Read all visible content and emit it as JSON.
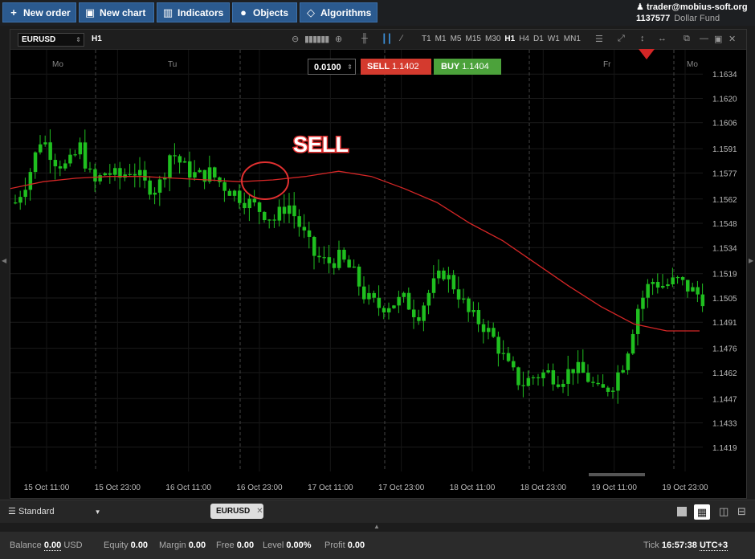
{
  "topbar": {
    "new_order": "New order",
    "new_chart": "New chart",
    "indicators": "Indicators",
    "objects": "Objects",
    "algorithms": "Algorithms"
  },
  "account": {
    "user": "trader@mobius-soft.org",
    "id": "1137577",
    "fund": "Dollar Fund"
  },
  "chart": {
    "symbol": "EURUSD",
    "timeframe": "H1",
    "timeframes": [
      "T1",
      "M1",
      "M5",
      "M15",
      "M30",
      "H1",
      "H4",
      "D1",
      "W1",
      "MN1"
    ],
    "selected_timeframe": "H1",
    "quantity": "0.0100",
    "sell_label": "SELL",
    "sell_price": "1.1402",
    "buy_label": "BUY",
    "buy_price": "1.1404",
    "annotation": "SELL",
    "day_labels": [
      "Mo",
      "Tu",
      "Fr",
      "Mo"
    ],
    "price_ticks": [
      "1.1634",
      "1.1620",
      "1.1606",
      "1.1591",
      "1.1577",
      "1.1562",
      "1.1548",
      "1.1534",
      "1.1519",
      "1.1505",
      "1.1491",
      "1.1476",
      "1.1462",
      "1.1447",
      "1.1433",
      "1.1419"
    ],
    "time_ticks": [
      "15 Oct 11:00",
      "15 Oct 23:00",
      "16 Oct 11:00",
      "16 Oct 23:00",
      "17 Oct 11:00",
      "17 Oct 23:00",
      "18 Oct 11:00",
      "18 Oct 23:00",
      "19 Oct 11:00",
      "19 Oct 23:00"
    ]
  },
  "chart_data": {
    "type": "candlestick",
    "symbol": "EURUSD",
    "timeframe": "H1",
    "ylim": [
      1.1405,
      1.1648
    ],
    "x": [
      "15 Oct 11:00",
      "15 Oct 23:00",
      "16 Oct 11:00",
      "16 Oct 23:00",
      "17 Oct 11:00",
      "17 Oct 23:00",
      "18 Oct 11:00",
      "18 Oct 23:00",
      "19 Oct 11:00",
      "19 Oct 23:00"
    ],
    "close_path": [
      1.156,
      1.1575,
      1.1598,
      1.1585,
      1.158,
      1.1592,
      1.157,
      1.1578,
      1.1574,
      1.158,
      1.157,
      1.1568,
      1.159,
      1.158,
      1.1575,
      1.1577,
      1.157,
      1.1565,
      1.156,
      1.1555,
      1.155,
      1.156,
      1.1545,
      1.153,
      1.1525,
      1.1528,
      1.152,
      1.1505,
      1.15,
      1.1502,
      1.1504,
      1.1495,
      1.151,
      1.152,
      1.151,
      1.1495,
      1.149,
      1.148,
      1.1465,
      1.1455,
      1.146,
      1.1462,
      1.1458,
      1.1465,
      1.146,
      1.145,
      1.1455,
      1.147,
      1.15,
      1.1515,
      1.1512,
      1.1515,
      1.151,
      1.1505
    ],
    "ma_path": [
      1.1568,
      1.1572,
      1.1574,
      1.1575,
      1.1575,
      1.1574,
      1.1573,
      1.1572,
      1.1573,
      1.1575,
      1.1578,
      1.1575,
      1.1568,
      1.156,
      1.1548,
      1.1538,
      1.1525,
      1.1512,
      1.15,
      1.149,
      1.1486,
      1.1486
    ]
  },
  "bottombar": {
    "preset": "Standard",
    "tab": "EURUSD"
  },
  "status": {
    "balance_label": "Balance",
    "balance": "0.00",
    "currency": "USD",
    "equity_label": "Equity",
    "equity": "0.00",
    "margin_label": "Margin",
    "margin": "0.00",
    "free_label": "Free",
    "free": "0.00",
    "level_label": "Level",
    "level": "0.00%",
    "profit_label": "Profit",
    "profit": "0.00",
    "tick_label": "Tick",
    "tick_time": "16:57:38",
    "timezone": "UTC+3"
  },
  "colors": {
    "accent": "#2b5a8f",
    "sell": "#d43a2e",
    "buy": "#4ca23b",
    "candle": "#1fbf1f",
    "ma": "#d42626"
  }
}
